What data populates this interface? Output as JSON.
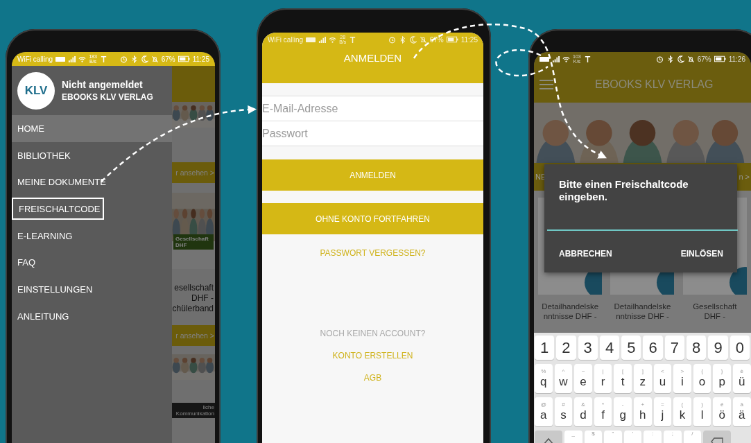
{
  "phone_menu": {
    "status_bar": {
      "label": "WiFi calling",
      "speed": "183",
      "speed_unit": "B/s",
      "battery": "67%",
      "time": "11:25"
    },
    "drawer": {
      "title": "Nicht angemeldet",
      "subtitle": "EBOOKS KLV VERLAG",
      "logo": "KLV",
      "items": [
        {
          "label": "HOME",
          "selected": true,
          "outlined": false
        },
        {
          "label": "BIBLIOTHEK",
          "selected": false,
          "outlined": false
        },
        {
          "label": "MEINE DOKUMENTE",
          "selected": false,
          "outlined": false
        },
        {
          "label": "FREISCHALTCODE",
          "selected": false,
          "outlined": true
        },
        {
          "label": "E-LEARNING",
          "selected": false,
          "outlined": false
        },
        {
          "label": "FAQ",
          "selected": false,
          "outlined": false
        },
        {
          "label": "EINSTELLUNGEN",
          "selected": false,
          "outlined": false
        },
        {
          "label": "ANLEITUNG",
          "selected": false,
          "outlined": false
        }
      ]
    },
    "behind": {
      "more_link_1": "r ansehen >",
      "cover_label": "Gesellschaft DHF",
      "book_title": "esellschaft DHF - chülerband",
      "more_link_2": "r ansehen >",
      "banner": "liche Kommunikation"
    }
  },
  "phone_login": {
    "status_bar": {
      "label": "WiFi calling",
      "speed": "28",
      "speed_unit": "B/s",
      "battery": "67%",
      "time": "11:25"
    },
    "title": "ANMELDEN",
    "fields": [
      {
        "placeholder": "E-Mail-Adresse"
      },
      {
        "placeholder": "Passwort"
      }
    ],
    "buttons": [
      "ANMELDEN",
      "OHNE KONTO FORTFAHREN"
    ],
    "forgot_link": "PASSWORT VERGESSEN?",
    "no_account": "NOCH KEINEN ACCOUNT?",
    "links": [
      "KONTO ERSTELLEN",
      "AGB"
    ]
  },
  "phone_redeem": {
    "status_bar": {
      "speed": "103",
      "speed_unit": "K/s",
      "battery": "67%",
      "time": "11:26"
    },
    "app_title": "EBOOKS KLV VERLAG",
    "band_left": "NE",
    "band_right": "n >",
    "books": [
      {
        "title": "Detailhandelske nntnisse DHF -"
      },
      {
        "title": "Detailhandelske nntnisse DHF -"
      },
      {
        "title": "Gesellschaft DHF -"
      }
    ],
    "dialog": {
      "title": "Bitte einen Freischaltcode eingeben.",
      "buttons": [
        "ABBRECHEN",
        "EINLÖSEN"
      ]
    },
    "keyboard": [
      [
        {
          "kind": "char",
          "main": "1"
        },
        {
          "kind": "char",
          "main": "2"
        },
        {
          "kind": "char",
          "main": "3"
        },
        {
          "kind": "char",
          "main": "4"
        },
        {
          "kind": "char",
          "main": "5"
        },
        {
          "kind": "char",
          "main": "6"
        },
        {
          "kind": "char",
          "main": "7"
        },
        {
          "kind": "char",
          "main": "8"
        },
        {
          "kind": "char",
          "main": "9"
        },
        {
          "kind": "char",
          "main": "0"
        }
      ],
      [
        {
          "kind": "char",
          "main": "q",
          "alt": "%"
        },
        {
          "kind": "char",
          "main": "w",
          "alt": "^"
        },
        {
          "kind": "char",
          "main": "e",
          "alt": "~"
        },
        {
          "kind": "char",
          "main": "r",
          "alt": "|"
        },
        {
          "kind": "char",
          "main": "t",
          "alt": "["
        },
        {
          "kind": "char",
          "main": "z",
          "alt": "]"
        },
        {
          "kind": "char",
          "main": "u",
          "alt": "<"
        },
        {
          "kind": "char",
          "main": "i",
          "alt": ">"
        },
        {
          "kind": "char",
          "main": "o",
          "alt": "{"
        },
        {
          "kind": "char",
          "main": "p",
          "alt": "}"
        },
        {
          "kind": "char",
          "main": "ü",
          "alt": "è"
        }
      ],
      [
        {
          "kind": "char",
          "main": "a",
          "alt": "@"
        },
        {
          "kind": "char",
          "main": "s",
          "alt": "#"
        },
        {
          "kind": "char",
          "main": "d",
          "alt": "&"
        },
        {
          "kind": "char",
          "main": "f",
          "alt": "*"
        },
        {
          "kind": "char",
          "main": "g",
          "alt": "-"
        },
        {
          "kind": "char",
          "main": "h",
          "alt": "+"
        },
        {
          "kind": "char",
          "main": "j",
          "alt": "="
        },
        {
          "kind": "char",
          "main": "k",
          "alt": "("
        },
        {
          "kind": "char",
          "main": "l",
          "alt": ")"
        },
        {
          "kind": "char",
          "main": "ö",
          "alt": "é"
        },
        {
          "kind": "char",
          "main": "ä",
          "alt": "à"
        }
      ],
      [
        {
          "kind": "shift"
        },
        {
          "kind": "char",
          "alt": "_"
        },
        {
          "kind": "char",
          "alt": "$"
        },
        {
          "kind": "char",
          "alt": "\""
        },
        {
          "kind": "char",
          "alt": "'"
        },
        {
          "kind": "char",
          "alt": ":"
        },
        {
          "kind": "char",
          "alt": ";"
        },
        {
          "kind": "char",
          "alt": "/"
        },
        {
          "kind": "backspace"
        }
      ]
    ]
  }
}
